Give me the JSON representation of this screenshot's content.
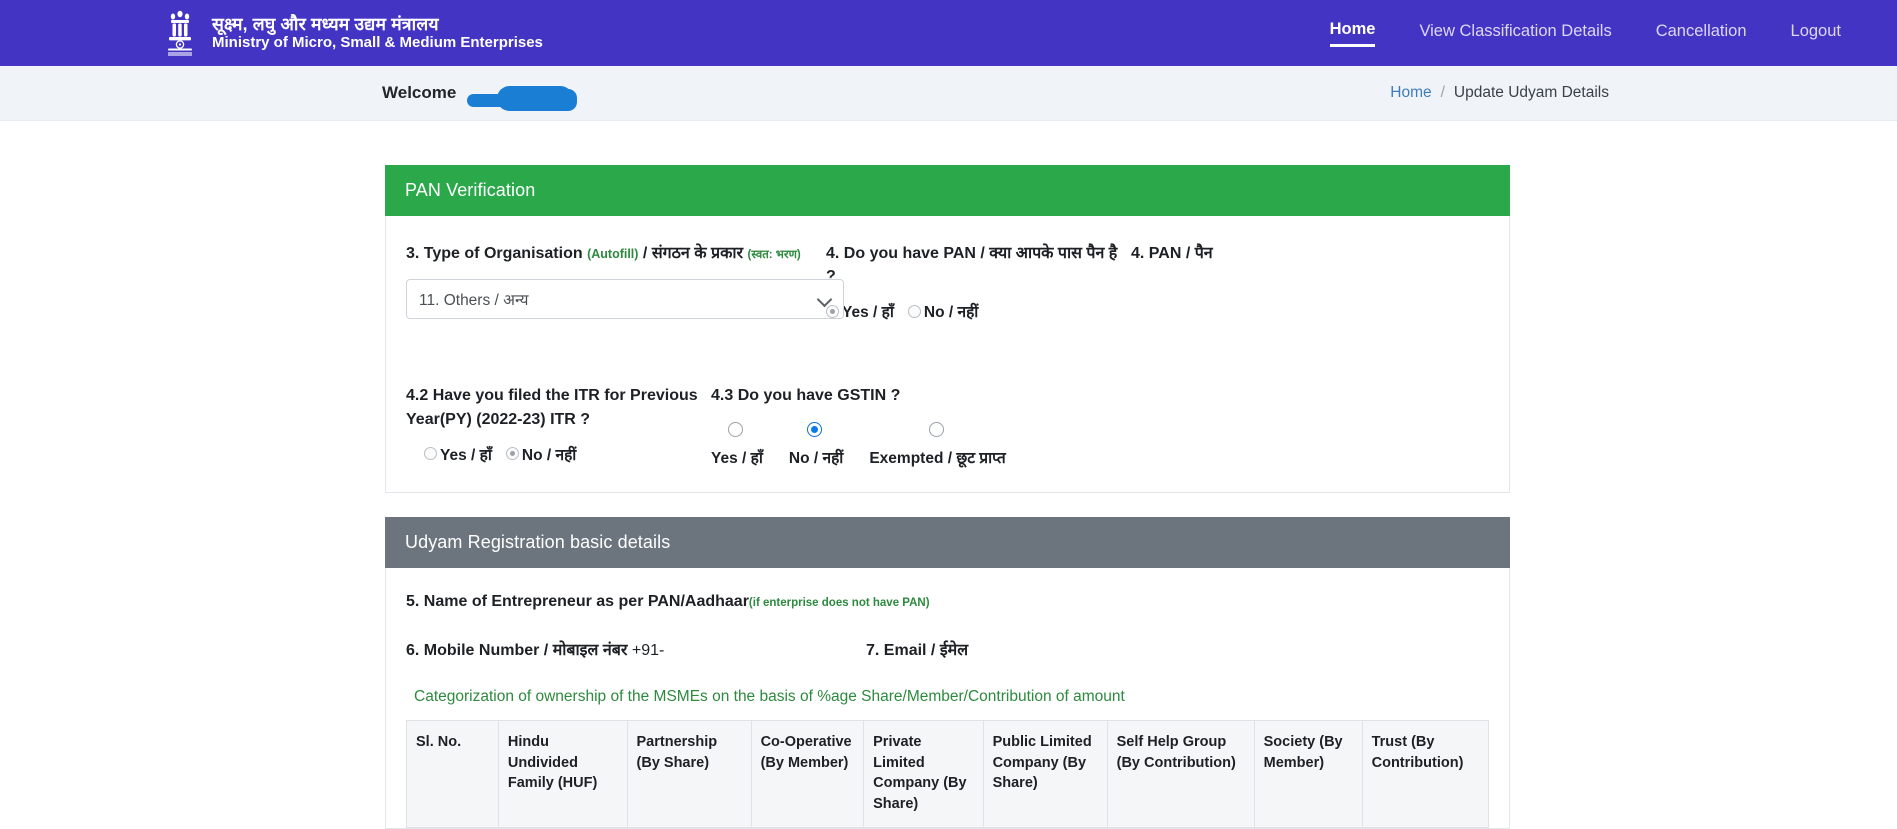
{
  "header": {
    "emblem_icon": "india-national-emblem-icon",
    "brand_hindi": "सूक्ष्म, लघु और मध्यम उद्यम मंत्रालय",
    "brand_english": "Ministry of Micro, Small & Medium Enterprises",
    "accent_color": "#4434c4",
    "nav": [
      {
        "label": "Home",
        "active": true
      },
      {
        "label": "View Classification Details",
        "active": false
      },
      {
        "label": "Cancellation",
        "active": false
      },
      {
        "label": "Logout",
        "active": false
      }
    ]
  },
  "subbar": {
    "welcome_label": "Welcome",
    "welcome_value_redacted": "",
    "breadcrumb": {
      "home": "Home",
      "separator": "/",
      "current": "Update Udyam Details"
    }
  },
  "pan_section": {
    "title": "PAN Verification",
    "title_color": "#2aa84a",
    "org_type": {
      "label_num": "3.",
      "label_en": "Type of Organisation",
      "autofill_note": "(Autofill)",
      "slash": "/",
      "label_hi": "संगठन के प्रकार",
      "autofill_note_hi": "(स्वत: भरण)",
      "selected_value": "11. Others / अन्य",
      "chevron_icon": "chevron-down-icon"
    },
    "have_pan": {
      "label": "4. Do you have PAN / क्या आपके पास पैन है ?",
      "options": [
        {
          "label": "Yes / हाँ",
          "selected": true
        },
        {
          "label": "No / नहीं",
          "selected": false
        }
      ]
    },
    "pan_field": {
      "label": "4. PAN / पैन"
    },
    "itr": {
      "label_line1": "4.2 Have you filed the ITR for Previous",
      "label_line2": "Year(PY) (2022-23) ITR ?",
      "options": [
        {
          "label": "Yes / हाँ",
          "selected": false
        },
        {
          "label": "No / नहीं",
          "selected": true
        }
      ]
    },
    "gstin": {
      "label": "4.3 Do you have GSTIN ?",
      "options": [
        {
          "label": "Yes / हाँ",
          "selected": false
        },
        {
          "label": "No / नहीं",
          "selected": true
        },
        {
          "label": "Exempted / छूट प्राप्त",
          "selected": false
        }
      ]
    }
  },
  "basic_section": {
    "title": "Udyam Registration basic details",
    "title_color": "#6c757d",
    "entrepreneur_name": {
      "label": "5. Name of Entrepreneur as per PAN/Aadhaar",
      "note": "(if enterprise does not have PAN)"
    },
    "mobile": {
      "label": "6. Mobile Number / मोबाइल नंबर",
      "prefix": "+91-"
    },
    "email": {
      "label": "7. Email / ईमेल"
    },
    "categorization_heading": "Categorization of ownership of the MSMEs on the basis of %age Share/Member/Contribution of amount",
    "table_headers": [
      "Sl. No.",
      "Hindu Undivided Family (HUF)",
      "Partnership (By Share)",
      "Co-Operative (By Member)",
      "Private Limited Company (By Share)",
      "Public Limited Company (By Share)",
      "Self Help Group (By Contribution)",
      "Society (By Member)",
      "Trust (By Contribution)"
    ]
  }
}
